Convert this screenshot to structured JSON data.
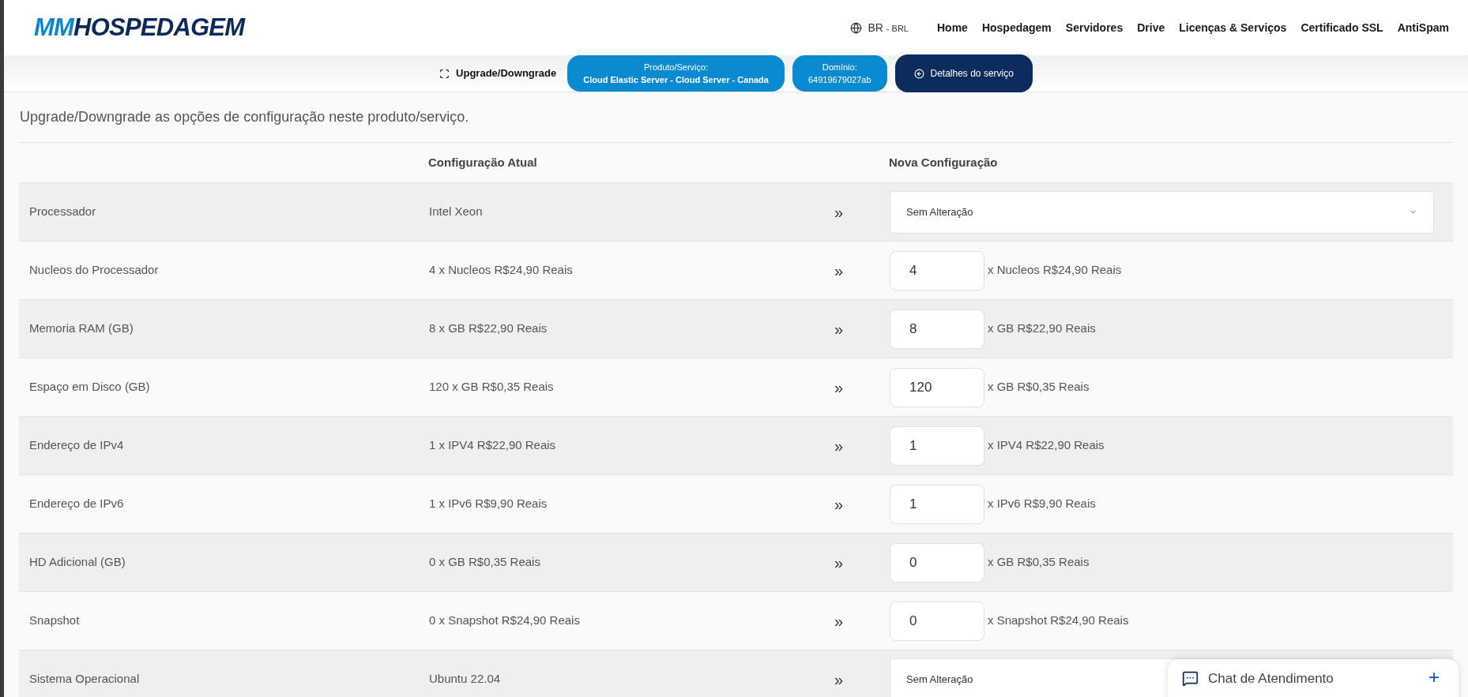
{
  "logo": {
    "part_1": "MM",
    "part_2": "HOSPEDAGEM"
  },
  "locale": {
    "country": "BR",
    "separator": "-",
    "currency": "BRL"
  },
  "nav": [
    "Home",
    "Hospedagem",
    "Servidores",
    "Drive",
    "Licenças & Serviços",
    "Certificado SSL",
    "AntiSpam"
  ],
  "subbar": {
    "title": "Upgrade/Downgrade",
    "product_label": "Produto/Serviço:",
    "product_value": "Cloud Elastic Server - Cloud Server - Canada",
    "domain_label": "Domínio:",
    "domain_value": "64919679027ab",
    "details_button": "Detalhes do serviço"
  },
  "intro": "Upgrade/Downgrade as opções de configuração neste produto/serviço.",
  "table": {
    "columns": [
      "Configuração Atual",
      "Nova Configuração"
    ],
    "rows": [
      {
        "kind": "select",
        "label": "Processador",
        "current": "Intel Xeon",
        "arrow": "»",
        "value": "Sem Alteração"
      },
      {
        "kind": "number",
        "label": "Nucleos do Processador",
        "current": "4 x Nucleos R$24,90 Reais",
        "arrow": "»",
        "value": "4",
        "unit": "x Nucleos R$24,90 Reais"
      },
      {
        "kind": "number",
        "label": "Memoria RAM (GB)",
        "current": "8 x GB R$22,90 Reais",
        "arrow": "»",
        "value": "8",
        "unit": "x GB R$22,90 Reais"
      },
      {
        "kind": "number",
        "label": "Espaço em Disco (GB)",
        "current": "120 x GB R$0,35 Reais",
        "arrow": "»",
        "value": "120",
        "unit": "x GB R$0,35 Reais"
      },
      {
        "kind": "number",
        "label": "Endereço de IPv4",
        "current": "1 x IPV4 R$22,90 Reais",
        "arrow": "»",
        "value": "1",
        "unit": "x IPV4 R$22,90 Reais"
      },
      {
        "kind": "number",
        "label": "Endereço de IPv6",
        "current": "1 x IPv6 R$9,90 Reais",
        "arrow": "»",
        "value": "1",
        "unit": "x IPv6 R$9,90 Reais"
      },
      {
        "kind": "number",
        "label": "HD Adicional (GB)",
        "current": "0 x GB R$0,35 Reais",
        "arrow": "»",
        "value": "0",
        "unit": "x GB R$0,35 Reais"
      },
      {
        "kind": "number",
        "label": "Snapshot",
        "current": "0 x Snapshot R$24,90 Reais",
        "arrow": "»",
        "value": "0",
        "unit": "x Snapshot R$24,90 Reais"
      },
      {
        "kind": "select",
        "label": "Sistema Operacional",
        "current": "Ubuntu 22.04",
        "arrow": "»",
        "value": "Sem Alteração"
      }
    ]
  },
  "chat": {
    "title": "Chat de Atendimento",
    "plus": "+"
  }
}
